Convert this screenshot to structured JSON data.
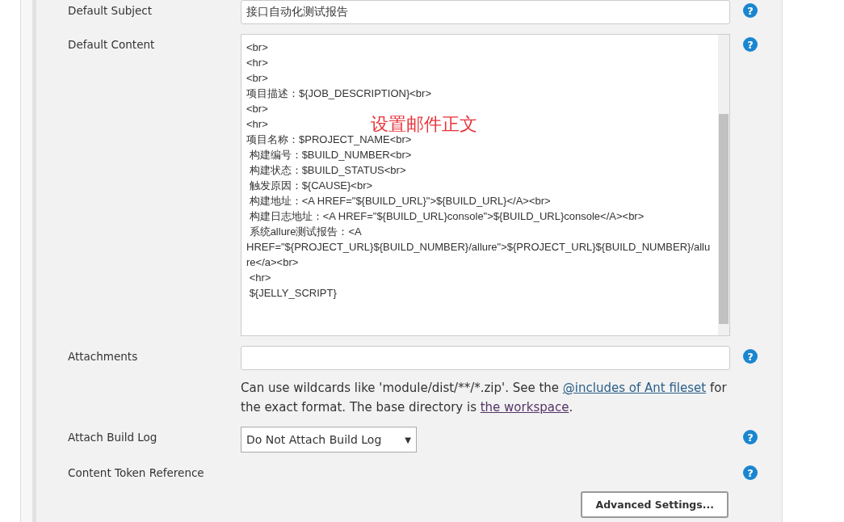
{
  "fields": [
    {
      "kind": "text",
      "label": "Default Subject",
      "value": "接口自动化测试报告",
      "help": "?"
    },
    {
      "kind": "textarea",
      "label": "Default Content",
      "lines": [
        "<br>",
        "<hr>",
        "<br>",
        "项目描述：${JOB_DESCRIPTION}<br>",
        "<br>",
        "<hr>",
        "项目名称：$PROJECT_NAME<br>",
        " 构建编号：$BUILD_NUMBER<br>",
        " 构建状态：$BUILD_STATUS<br>",
        " 触发原因：${CAUSE}<br>",
        " 构建地址：<A HREF=\"${BUILD_URL}\">${BUILD_URL}</A><br>",
        " 构建日志地址：<A HREF=\"${BUILD_URL}console\">${BUILD_URL}console</A><br>",
        " 系统allure测试报告：<A HREF=\"${PROJECT_URL}${BUILD_NUMBER}/allure\">${PROJECT_URL}${BUILD_NUMBER}/allure</a><br>",
        " <hr>",
        " ${JELLY_SCRIPT}"
      ],
      "annotation": "设置邮件正文",
      "help": "?"
    },
    {
      "kind": "text",
      "label": "Attachments",
      "help": "?",
      "hint": [
        "Can use wildcards like 'module/dist/**/*.zip'. See the ",
        "@includes of Ant fileset",
        " for the exact format. The base directory is ",
        "the workspace",
        "."
      ]
    },
    {
      "kind": "select",
      "label": "Attach Build Log",
      "value": "Do Not Attach Build Log",
      "arrow": "▼",
      "help": "?"
    },
    {
      "kind": "none",
      "label": "Content Token Reference",
      "help": "?"
    }
  ],
  "advanced_button": "Advanced Settings..."
}
